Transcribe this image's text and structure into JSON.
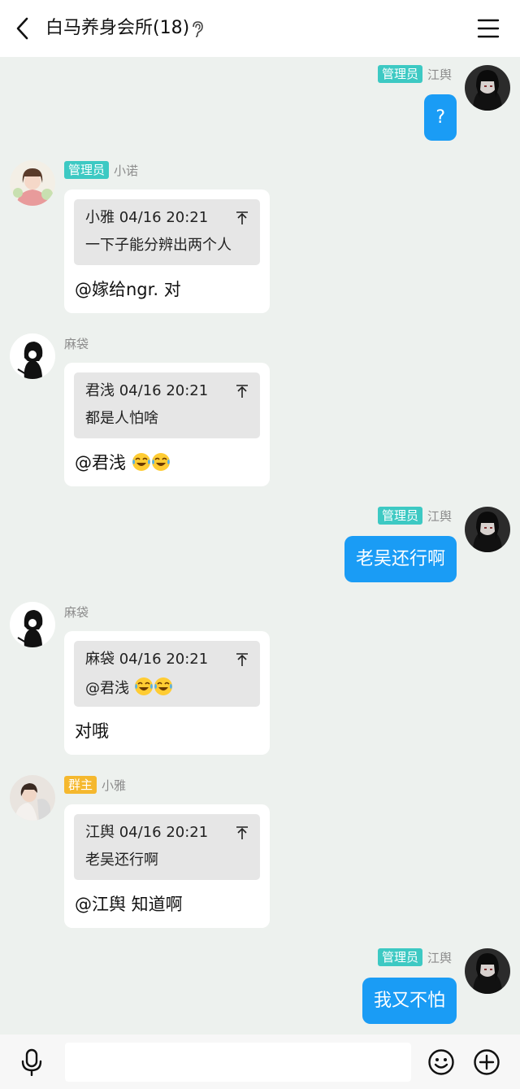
{
  "header": {
    "title": "白马养身会所(18)",
    "back_icon": "chevron-left-icon",
    "ear_icon": "ear-icon",
    "menu_icon": "menu-icon"
  },
  "messages": [
    {
      "sender": "江舆",
      "role": "管理员",
      "direction": "outgoing",
      "text": "?"
    },
    {
      "sender": "小诺",
      "role": "管理员",
      "direction": "incoming",
      "quote": {
        "author": "小雅",
        "time": "04/16 20:21",
        "text": "一下子能分辨出两个人"
      },
      "text": "@嫁给ngr. 对"
    },
    {
      "sender": "麻袋",
      "role": "",
      "direction": "incoming",
      "quote": {
        "author": "君浅",
        "time": "04/16 20:21",
        "text": "都是人怕啥"
      },
      "text": "@君浅"
    },
    {
      "sender": "江舆",
      "role": "管理员",
      "direction": "outgoing",
      "text": "老吴还行啊"
    },
    {
      "sender": "麻袋",
      "role": "",
      "direction": "incoming",
      "quote": {
        "author": "麻袋",
        "time": "04/16 20:21",
        "text": "@君浅"
      },
      "text": "对哦"
    },
    {
      "sender": "小雅",
      "role": "群主",
      "direction": "incoming",
      "quote": {
        "author": "江舆",
        "time": "04/16 20:21",
        "text": "老吴还行啊"
      },
      "text": "@江舆 知道啊"
    },
    {
      "sender": "江舆",
      "role": "管理员",
      "direction": "outgoing",
      "text": "我又不怕"
    }
  ],
  "emoji": "tears-of-joy-icon",
  "colors": {
    "background": "#edf1ee",
    "outgoing_bubble": "#1a9cf5",
    "admin_badge": "#3dc9c3",
    "owner_badge": "#f5b82e"
  },
  "bottom": {
    "input_placeholder": "",
    "mic_icon": "microphone-icon",
    "emoji_icon": "smiley-icon",
    "plus_icon": "plus-circle-icon"
  }
}
